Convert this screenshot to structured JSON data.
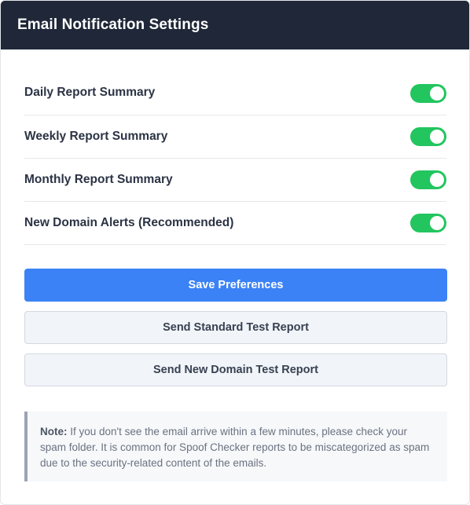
{
  "header": {
    "title": "Email Notification Settings"
  },
  "settings": [
    {
      "label": "Daily Report Summary",
      "enabled": true
    },
    {
      "label": "Weekly Report Summary",
      "enabled": true
    },
    {
      "label": "Monthly Report Summary",
      "enabled": true
    },
    {
      "label": "New Domain Alerts (Recommended)",
      "enabled": true
    }
  ],
  "actions": {
    "save_label": "Save Preferences",
    "standard_test_label": "Send Standard Test Report",
    "domain_test_label": "Send New Domain Test Report"
  },
  "note": {
    "label": "Note:",
    "text": " If you don't see the email arrive within a few minutes, please check your spam folder. It is common for Spoof Checker reports to be miscategorized as spam due to the security-related content of the emails."
  },
  "colors": {
    "header_bg": "#1f2738",
    "toggle_on": "#22c55e",
    "primary": "#3b82f6"
  }
}
